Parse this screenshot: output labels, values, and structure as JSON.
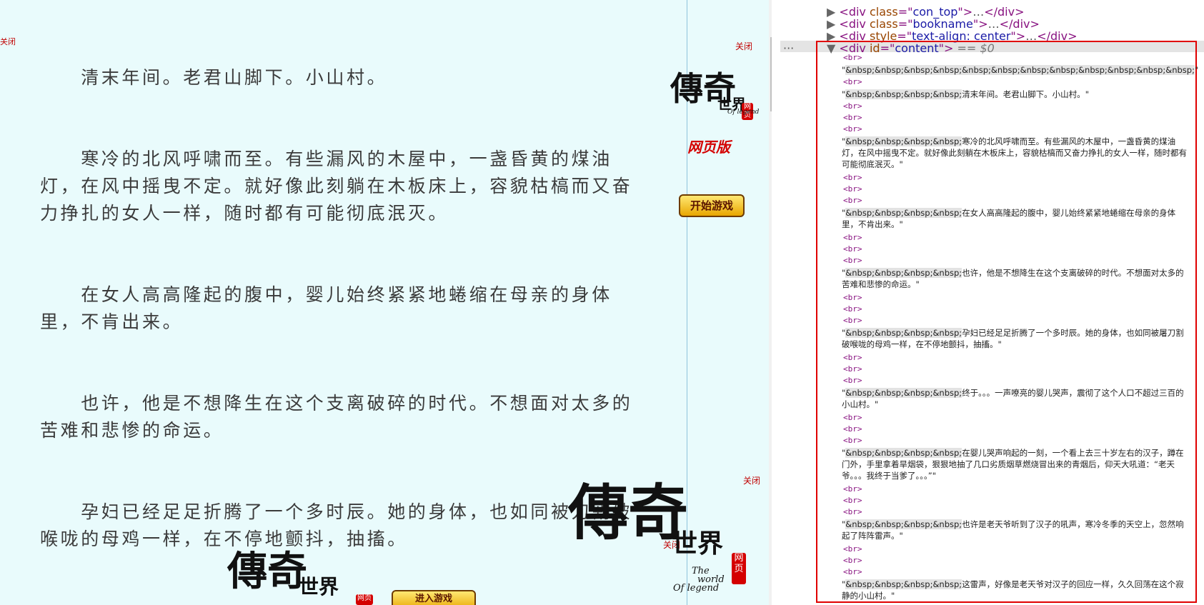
{
  "reader": {
    "paragraphs": [
      "　　清末年间。老君山脚下。小山村。",
      "　　寒冷的北风呼啸而至。有些漏风的木屋中，一盏昏黄的煤油灯，在风中摇曳不定。就好像此刻躺在木板床上，容貌枯槁而又奋力挣扎的女人一样，随时都有可能彻底泯灭。",
      "　　在女人高高隆起的腹中，婴儿始终紧紧地蜷缩在母亲的身体里，不肯出来。",
      "　　也许，他是不想降生在这个支离破碎的时代。不想面对太多的苦难和悲惨的命运。",
      "　　孕妇已经足足折腾了一个多时辰。她的身体，也如同被刀割破喉咙的母鸡一样，在不停地颤抖，抽搐。"
    ]
  },
  "ads": {
    "close_label": "关闭",
    "logo_main": "傳奇",
    "logo_world": "世界",
    "logo_sub1": "The",
    "logo_sub2": "world",
    "logo_sub3": "Of legend",
    "seal": "网页",
    "web_version": "网页版",
    "start_game": "开始游戏",
    "enter_game": "进入游戏"
  },
  "devtools": {
    "lines": [
      {
        "tag": "div",
        "attr": "class",
        "val": "con_top"
      },
      {
        "tag": "div",
        "attr": "class",
        "val": "bookname"
      },
      {
        "tag": "div",
        "attr": "style",
        "val": "text-align: center"
      }
    ],
    "selected": {
      "tag": "div",
      "attr": "id",
      "val": "content",
      "suffix": "== $0"
    },
    "ellipsis": "…",
    "br": "<br>",
    "text_nodes": [
      {
        "nbsp": "&nbsp;&nbsp;&nbsp;&nbsp;&nbsp;&nbsp;&nbsp;&nbsp;&nbsp;&nbsp;&nbsp;&nbsp;",
        "text": ""
      },
      {
        "nbsp": "&nbsp;&nbsp;&nbsp;&nbsp;",
        "text": "清末年间。老君山脚下。小山村。"
      },
      {
        "nbsp": "&nbsp;&nbsp;&nbsp;&nbsp;",
        "text": "寒冷的北风呼啸而至。有些漏风的木屋中，一盏昏黄的煤油灯，在风中摇曳不定。就好像此刻躺在木板床上，容貌枯槁而又奋力挣扎的女人一样，随时都有可能彻底泯灭。"
      },
      {
        "nbsp": "&nbsp;&nbsp;&nbsp;&nbsp;",
        "text": "在女人高高隆起的腹中，婴儿始终紧紧地蜷缩在母亲的身体里，不肯出来。"
      },
      {
        "nbsp": "&nbsp;&nbsp;&nbsp;&nbsp;",
        "text": "也许，他是不想降生在这个支离破碎的时代。不想面对太多的苦难和悲惨的命运。"
      },
      {
        "nbsp": "&nbsp;&nbsp;&nbsp;&nbsp;",
        "text": "孕妇已经足足折腾了一个多时辰。她的身体，也如同被屠刀割破喉咙的母鸡一样，在不停地颤抖，抽搐。"
      },
      {
        "nbsp": "&nbsp;&nbsp;&nbsp;&nbsp;",
        "text": "终于。。。一声嘹亮的婴儿哭声，震彻了这个人口不超过三百的小山村。"
      },
      {
        "nbsp": "&nbsp;&nbsp;&nbsp;&nbsp;",
        "text": "在婴儿哭声响起的一刻，一个看上去三十岁左右的汉子，蹲在门外，手里拿着旱烟袋，狠狠地抽了几口劣质烟草燃烧冒出来的青烟后，仰天大吼道：“老天爷。。。我终于当爹了。。。”"
      },
      {
        "nbsp": "&nbsp;&nbsp;&nbsp;&nbsp;",
        "text": "也许是老天爷听到了汉子的吼声，寒冷冬季的天空上，忽然响起了阵阵雷声。"
      },
      {
        "nbsp": "&nbsp;&nbsp;&nbsp;&nbsp;",
        "text": "这雷声，好像是老天爷对汉子的回应一样，久久回荡在这个寂静的小山村。"
      }
    ]
  }
}
